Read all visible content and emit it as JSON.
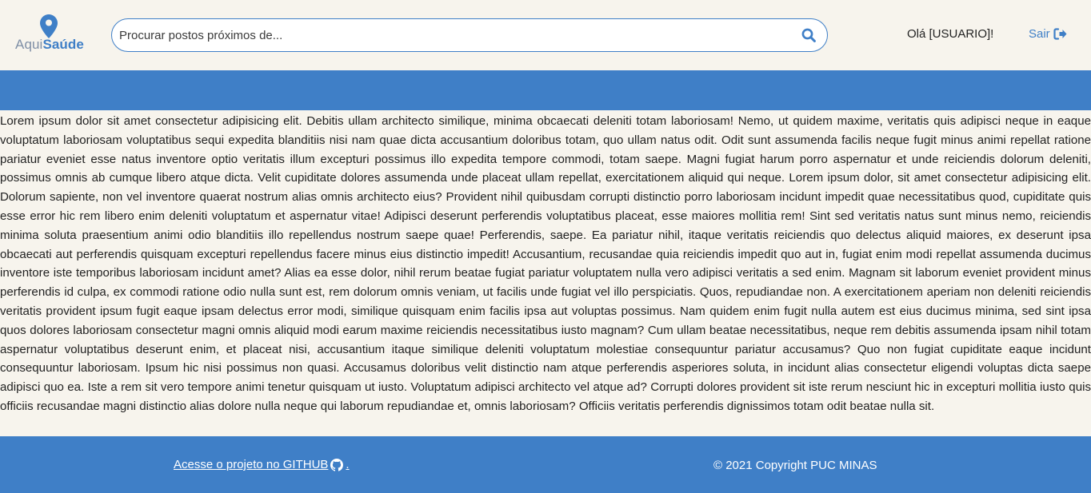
{
  "brand": {
    "part1": "Aqui",
    "part2": "Saúde",
    "accent": "#3f7fc7"
  },
  "search": {
    "placeholder": "Procurar postos próximos de...",
    "value": "",
    "icon": "search-icon"
  },
  "user": {
    "greeting": "Olá [USUARIO]!",
    "logout_label": "Sair",
    "logout_icon": "sign-out-icon"
  },
  "main": {
    "text": "Lorem ipsum dolor sit amet consectetur adipisicing elit. Debitis ullam architecto similique, minima obcaecati deleniti totam laboriosam! Nemo, ut quidem maxime, veritatis quis adipisci neque in eaque voluptatum laboriosam voluptatibus sequi expedita blanditiis nisi nam quae dicta accusantium doloribus totam, quo ullam natus odit. Odit sunt assumenda facilis neque fugit minus animi repellat ratione pariatur eveniet esse natus inventore optio veritatis illum excepturi possimus illo expedita tempore commodi, totam saepe. Magni fugiat harum porro aspernatur et unde reiciendis dolorum deleniti, possimus omnis ab cumque libero atque dicta. Velit cupiditate dolores assumenda unde placeat ullam repellat, exercitationem aliquid qui neque. Lorem ipsum dolor, sit amet consectetur adipisicing elit. Dolorum sapiente, non vel inventore quaerat nostrum alias omnis architecto eius? Provident nihil quibusdam corrupti distinctio porro laboriosam incidunt impedit quae necessitatibus quod, cupiditate quis esse error hic rem libero enim deleniti voluptatum et aspernatur vitae! Adipisci deserunt perferendis voluptatibus placeat, esse maiores mollitia rem! Sint sed veritatis natus sunt minus nemo, reiciendis minima soluta praesentium animi odio blanditiis illo repellendus nostrum saepe quae! Perferendis, saepe. Ea pariatur nihil, itaque veritatis reiciendis quo delectus aliquid maiores, ex deserunt ipsa obcaecati aut perferendis quisquam excepturi repellendus facere minus eius distinctio impedit! Accusantium, recusandae quia reiciendis impedit quo aut in, fugiat enim modi repellat assumenda ducimus inventore iste temporibus laboriosam incidunt amet? Alias ea esse dolor, nihil rerum beatae fugiat pariatur voluptatem nulla vero adipisci veritatis a sed enim. Magnam sit laborum eveniet provident minus perferendis id culpa, ex commodi ratione odio nulla sunt est, rem dolorum omnis veniam, ut facilis unde fugiat vel illo perspiciatis. Quos, repudiandae non. A exercitationem aperiam non deleniti reiciendis veritatis provident ipsum fugit eaque ipsam delectus error modi, similique quisquam enim facilis ipsa aut voluptas possimus. Nam quidem enim fugit nulla autem est eius ducimus minima, sed sint ipsa quos dolores laboriosam consectetur magni omnis aliquid modi earum maxime reiciendis necessitatibus iusto magnam? Cum ullam beatae necessitatibus, neque rem debitis assumenda ipsam nihil totam aspernatur voluptatibus deserunt enim, et placeat nisi, accusantium itaque similique deleniti voluptatum molestiae consequuntur pariatur accusamus? Quo non fugiat cupiditate eaque incidunt consequuntur laboriosam. Ipsum hic nisi possimus non quasi. Accusamus doloribus velit distinctio nam atque perferendis asperiores soluta, in incidunt alias consectetur eligendi voluptas dicta saepe adipisci quo ea. Iste a rem sit vero tempore animi tenetur quisquam ut iusto. Voluptatum adipisci architecto vel atque ad? Corrupti dolores provident sit iste rerum nesciunt hic in excepturi mollitia iusto quis officiis recusandae magni distinctio alias dolore nulla neque qui laborum repudiandae et, omnis laboriosam? Officiis veritatis perferendis dignissimos totam odit beatae nulla sit."
  },
  "footer": {
    "github_label": "Acesse o projeto no GITHUB",
    "github_suffix": ".",
    "github_icon": "github-icon",
    "copyright": "© 2021 Copyright PUC MINAS"
  },
  "colors": {
    "background": "#f7f4ed",
    "band": "#3f7fc7"
  }
}
